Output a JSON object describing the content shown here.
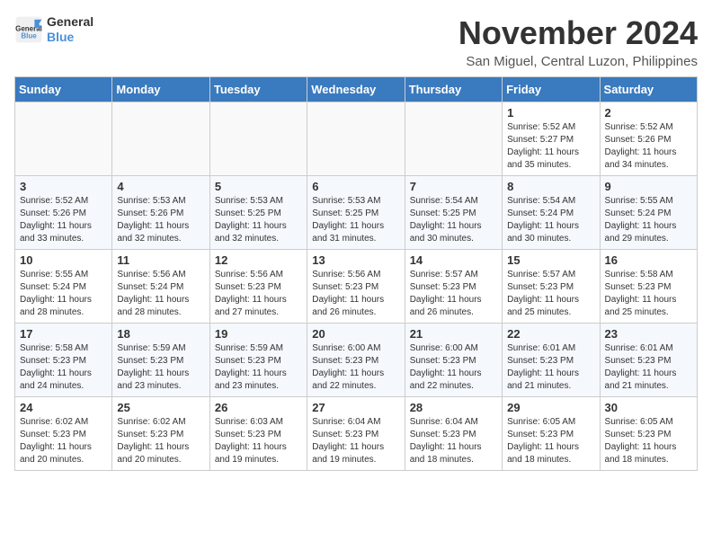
{
  "logo": {
    "line1": "General",
    "line2": "Blue"
  },
  "title": "November 2024",
  "location": "San Miguel, Central Luzon, Philippines",
  "weekdays": [
    "Sunday",
    "Monday",
    "Tuesday",
    "Wednesday",
    "Thursday",
    "Friday",
    "Saturday"
  ],
  "weeks": [
    [
      {
        "day": "",
        "info": ""
      },
      {
        "day": "",
        "info": ""
      },
      {
        "day": "",
        "info": ""
      },
      {
        "day": "",
        "info": ""
      },
      {
        "day": "",
        "info": ""
      },
      {
        "day": "1",
        "info": "Sunrise: 5:52 AM\nSunset: 5:27 PM\nDaylight: 11 hours\nand 35 minutes."
      },
      {
        "day": "2",
        "info": "Sunrise: 5:52 AM\nSunset: 5:26 PM\nDaylight: 11 hours\nand 34 minutes."
      }
    ],
    [
      {
        "day": "3",
        "info": "Sunrise: 5:52 AM\nSunset: 5:26 PM\nDaylight: 11 hours\nand 33 minutes."
      },
      {
        "day": "4",
        "info": "Sunrise: 5:53 AM\nSunset: 5:26 PM\nDaylight: 11 hours\nand 32 minutes."
      },
      {
        "day": "5",
        "info": "Sunrise: 5:53 AM\nSunset: 5:25 PM\nDaylight: 11 hours\nand 32 minutes."
      },
      {
        "day": "6",
        "info": "Sunrise: 5:53 AM\nSunset: 5:25 PM\nDaylight: 11 hours\nand 31 minutes."
      },
      {
        "day": "7",
        "info": "Sunrise: 5:54 AM\nSunset: 5:25 PM\nDaylight: 11 hours\nand 30 minutes."
      },
      {
        "day": "8",
        "info": "Sunrise: 5:54 AM\nSunset: 5:24 PM\nDaylight: 11 hours\nand 30 minutes."
      },
      {
        "day": "9",
        "info": "Sunrise: 5:55 AM\nSunset: 5:24 PM\nDaylight: 11 hours\nand 29 minutes."
      }
    ],
    [
      {
        "day": "10",
        "info": "Sunrise: 5:55 AM\nSunset: 5:24 PM\nDaylight: 11 hours\nand 28 minutes."
      },
      {
        "day": "11",
        "info": "Sunrise: 5:56 AM\nSunset: 5:24 PM\nDaylight: 11 hours\nand 28 minutes."
      },
      {
        "day": "12",
        "info": "Sunrise: 5:56 AM\nSunset: 5:23 PM\nDaylight: 11 hours\nand 27 minutes."
      },
      {
        "day": "13",
        "info": "Sunrise: 5:56 AM\nSunset: 5:23 PM\nDaylight: 11 hours\nand 26 minutes."
      },
      {
        "day": "14",
        "info": "Sunrise: 5:57 AM\nSunset: 5:23 PM\nDaylight: 11 hours\nand 26 minutes."
      },
      {
        "day": "15",
        "info": "Sunrise: 5:57 AM\nSunset: 5:23 PM\nDaylight: 11 hours\nand 25 minutes."
      },
      {
        "day": "16",
        "info": "Sunrise: 5:58 AM\nSunset: 5:23 PM\nDaylight: 11 hours\nand 25 minutes."
      }
    ],
    [
      {
        "day": "17",
        "info": "Sunrise: 5:58 AM\nSunset: 5:23 PM\nDaylight: 11 hours\nand 24 minutes."
      },
      {
        "day": "18",
        "info": "Sunrise: 5:59 AM\nSunset: 5:23 PM\nDaylight: 11 hours\nand 23 minutes."
      },
      {
        "day": "19",
        "info": "Sunrise: 5:59 AM\nSunset: 5:23 PM\nDaylight: 11 hours\nand 23 minutes."
      },
      {
        "day": "20",
        "info": "Sunrise: 6:00 AM\nSunset: 5:23 PM\nDaylight: 11 hours\nand 22 minutes."
      },
      {
        "day": "21",
        "info": "Sunrise: 6:00 AM\nSunset: 5:23 PM\nDaylight: 11 hours\nand 22 minutes."
      },
      {
        "day": "22",
        "info": "Sunrise: 6:01 AM\nSunset: 5:23 PM\nDaylight: 11 hours\nand 21 minutes."
      },
      {
        "day": "23",
        "info": "Sunrise: 6:01 AM\nSunset: 5:23 PM\nDaylight: 11 hours\nand 21 minutes."
      }
    ],
    [
      {
        "day": "24",
        "info": "Sunrise: 6:02 AM\nSunset: 5:23 PM\nDaylight: 11 hours\nand 20 minutes."
      },
      {
        "day": "25",
        "info": "Sunrise: 6:02 AM\nSunset: 5:23 PM\nDaylight: 11 hours\nand 20 minutes."
      },
      {
        "day": "26",
        "info": "Sunrise: 6:03 AM\nSunset: 5:23 PM\nDaylight: 11 hours\nand 19 minutes."
      },
      {
        "day": "27",
        "info": "Sunrise: 6:04 AM\nSunset: 5:23 PM\nDaylight: 11 hours\nand 19 minutes."
      },
      {
        "day": "28",
        "info": "Sunrise: 6:04 AM\nSunset: 5:23 PM\nDaylight: 11 hours\nand 18 minutes."
      },
      {
        "day": "29",
        "info": "Sunrise: 6:05 AM\nSunset: 5:23 PM\nDaylight: 11 hours\nand 18 minutes."
      },
      {
        "day": "30",
        "info": "Sunrise: 6:05 AM\nSunset: 5:23 PM\nDaylight: 11 hours\nand 18 minutes."
      }
    ]
  ]
}
